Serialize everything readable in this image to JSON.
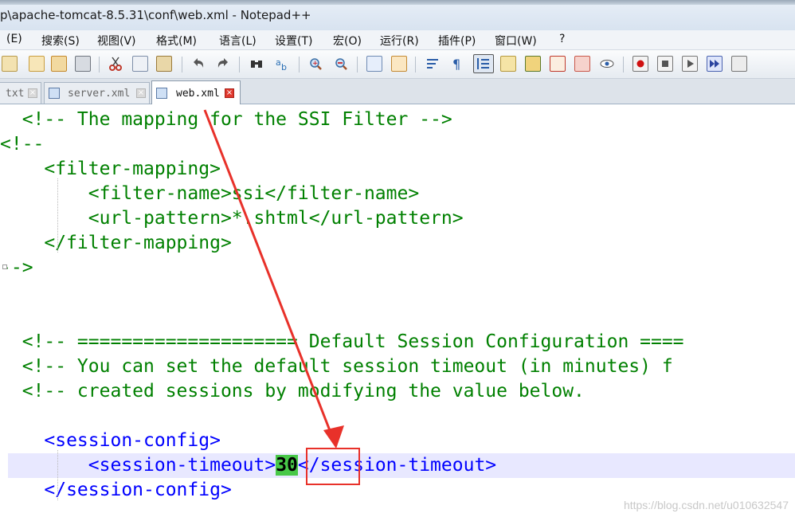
{
  "window": {
    "title": "p\\apache-tomcat-8.5.31\\conf\\web.xml - Notepad++"
  },
  "menu": [
    {
      "label": "(E)"
    },
    {
      "label": "搜索(S)"
    },
    {
      "label": "视图(V)"
    },
    {
      "label": "格式(M)"
    },
    {
      "label": "语言(L)"
    },
    {
      "label": "设置(T)"
    },
    {
      "label": "宏(O)"
    },
    {
      "label": "运行(R)"
    },
    {
      "label": "插件(P)"
    },
    {
      "label": "窗口(W)"
    },
    {
      "label": "?"
    }
  ],
  "toolbar": {
    "icons": [
      "new-file-icon",
      "open-file-icon",
      "save-icon",
      "print-icon",
      "cut-icon",
      "copy-icon",
      "paste-icon",
      "undo-icon",
      "redo-icon",
      "find-icon",
      "replace-icon",
      "zoom-in-icon",
      "zoom-out-icon",
      "sync-vertical-icon",
      "sync-horizontal-icon",
      "word-wrap-icon",
      "show-all-chars-icon",
      "indent-guide-icon",
      "function-list-icon",
      "document-map-icon",
      "folder-workspace-icon",
      "monitor-icon",
      "record-macro-icon",
      "stop-record-icon",
      "playback-macro-icon",
      "run-macro-multiple-icon",
      "save-macro-icon"
    ]
  },
  "tabs": [
    {
      "label": "txt",
      "active": false
    },
    {
      "label": "server.xml",
      "active": false
    },
    {
      "label": "web.xml",
      "active": true
    }
  ],
  "editor": {
    "lines": [
      {
        "segments": [
          {
            "t": "  <!-- The mapping for the SSI Filter -->",
            "c": "cmt"
          }
        ]
      },
      {
        "segments": [
          {
            "t": "<!--",
            "c": "cmt"
          }
        ]
      },
      {
        "segments": [
          {
            "t": "    <filter-mapping>",
            "c": "cmt"
          }
        ]
      },
      {
        "segments": [
          {
            "t": "        <filter-name>ssi</filter-name>",
            "c": "cmt"
          }
        ]
      },
      {
        "segments": [
          {
            "t": "        <url-pattern>*.shtml</url-pattern>",
            "c": "cmt"
          }
        ]
      },
      {
        "segments": [
          {
            "t": "    </filter-mapping>",
            "c": "cmt"
          }
        ]
      },
      {
        "segments": [
          {
            "t": "-->",
            "c": "cmt"
          }
        ]
      },
      {
        "segments": [
          {
            "t": "",
            "c": "txt"
          }
        ]
      },
      {
        "segments": [
          {
            "t": "",
            "c": "txt"
          }
        ]
      },
      {
        "segments": [
          {
            "t": "  <!-- ==================== Default Session Configuration ====",
            "c": "cmt"
          }
        ]
      },
      {
        "segments": [
          {
            "t": "  <!-- You can set the default session timeout (in minutes) f",
            "c": "cmt"
          }
        ]
      },
      {
        "segments": [
          {
            "t": "  <!-- created sessions by modifying the value below.",
            "c": "cmt"
          }
        ]
      },
      {
        "segments": [
          {
            "t": "",
            "c": "txt"
          }
        ]
      },
      {
        "segments": [
          {
            "t": "    <session-config>",
            "c": "tag"
          }
        ]
      },
      {
        "segments": [
          {
            "t": "        <session-timeout>",
            "c": "tag"
          },
          {
            "t": "30",
            "c": "num"
          },
          {
            "t": "</session-timeout>",
            "c": "tag"
          }
        ],
        "current": true
      },
      {
        "segments": [
          {
            "t": "    </session-config>",
            "c": "tag"
          }
        ]
      }
    ]
  },
  "watermark": "https://blog.csdn.net/u010632547",
  "colors": {
    "comment": "#008000",
    "tag": "#0000ff",
    "annotation": "#e8312a",
    "current_line": "#e8e8ff",
    "selection": "#48c848"
  }
}
